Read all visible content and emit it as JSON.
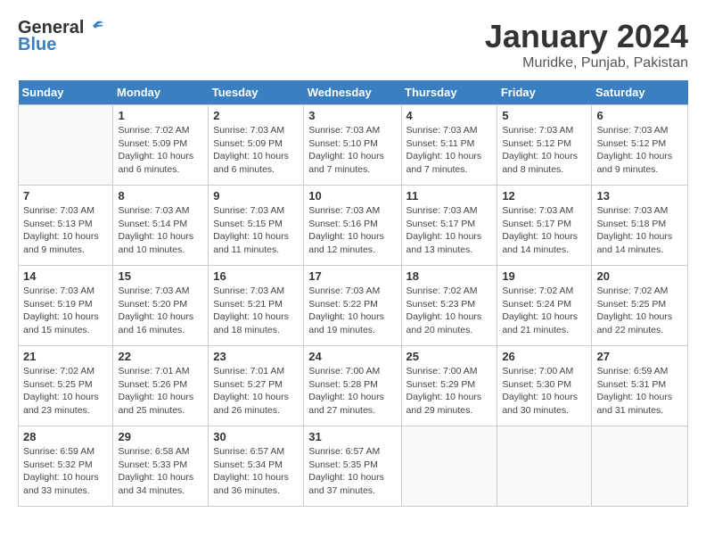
{
  "header": {
    "logo_general": "General",
    "logo_blue": "Blue",
    "month_year": "January 2024",
    "location": "Muridke, Punjab, Pakistan"
  },
  "columns": [
    "Sunday",
    "Monday",
    "Tuesday",
    "Wednesday",
    "Thursday",
    "Friday",
    "Saturday"
  ],
  "weeks": [
    [
      {
        "day": "",
        "info": ""
      },
      {
        "day": "1",
        "info": "Sunrise: 7:02 AM\nSunset: 5:09 PM\nDaylight: 10 hours\nand 6 minutes."
      },
      {
        "day": "2",
        "info": "Sunrise: 7:03 AM\nSunset: 5:09 PM\nDaylight: 10 hours\nand 6 minutes."
      },
      {
        "day": "3",
        "info": "Sunrise: 7:03 AM\nSunset: 5:10 PM\nDaylight: 10 hours\nand 7 minutes."
      },
      {
        "day": "4",
        "info": "Sunrise: 7:03 AM\nSunset: 5:11 PM\nDaylight: 10 hours\nand 7 minutes."
      },
      {
        "day": "5",
        "info": "Sunrise: 7:03 AM\nSunset: 5:12 PM\nDaylight: 10 hours\nand 8 minutes."
      },
      {
        "day": "6",
        "info": "Sunrise: 7:03 AM\nSunset: 5:12 PM\nDaylight: 10 hours\nand 9 minutes."
      }
    ],
    [
      {
        "day": "7",
        "info": "Sunrise: 7:03 AM\nSunset: 5:13 PM\nDaylight: 10 hours\nand 9 minutes."
      },
      {
        "day": "8",
        "info": "Sunrise: 7:03 AM\nSunset: 5:14 PM\nDaylight: 10 hours\nand 10 minutes."
      },
      {
        "day": "9",
        "info": "Sunrise: 7:03 AM\nSunset: 5:15 PM\nDaylight: 10 hours\nand 11 minutes."
      },
      {
        "day": "10",
        "info": "Sunrise: 7:03 AM\nSunset: 5:16 PM\nDaylight: 10 hours\nand 12 minutes."
      },
      {
        "day": "11",
        "info": "Sunrise: 7:03 AM\nSunset: 5:17 PM\nDaylight: 10 hours\nand 13 minutes."
      },
      {
        "day": "12",
        "info": "Sunrise: 7:03 AM\nSunset: 5:17 PM\nDaylight: 10 hours\nand 14 minutes."
      },
      {
        "day": "13",
        "info": "Sunrise: 7:03 AM\nSunset: 5:18 PM\nDaylight: 10 hours\nand 14 minutes."
      }
    ],
    [
      {
        "day": "14",
        "info": "Sunrise: 7:03 AM\nSunset: 5:19 PM\nDaylight: 10 hours\nand 15 minutes."
      },
      {
        "day": "15",
        "info": "Sunrise: 7:03 AM\nSunset: 5:20 PM\nDaylight: 10 hours\nand 16 minutes."
      },
      {
        "day": "16",
        "info": "Sunrise: 7:03 AM\nSunset: 5:21 PM\nDaylight: 10 hours\nand 18 minutes."
      },
      {
        "day": "17",
        "info": "Sunrise: 7:03 AM\nSunset: 5:22 PM\nDaylight: 10 hours\nand 19 minutes."
      },
      {
        "day": "18",
        "info": "Sunrise: 7:02 AM\nSunset: 5:23 PM\nDaylight: 10 hours\nand 20 minutes."
      },
      {
        "day": "19",
        "info": "Sunrise: 7:02 AM\nSunset: 5:24 PM\nDaylight: 10 hours\nand 21 minutes."
      },
      {
        "day": "20",
        "info": "Sunrise: 7:02 AM\nSunset: 5:25 PM\nDaylight: 10 hours\nand 22 minutes."
      }
    ],
    [
      {
        "day": "21",
        "info": "Sunrise: 7:02 AM\nSunset: 5:25 PM\nDaylight: 10 hours\nand 23 minutes."
      },
      {
        "day": "22",
        "info": "Sunrise: 7:01 AM\nSunset: 5:26 PM\nDaylight: 10 hours\nand 25 minutes."
      },
      {
        "day": "23",
        "info": "Sunrise: 7:01 AM\nSunset: 5:27 PM\nDaylight: 10 hours\nand 26 minutes."
      },
      {
        "day": "24",
        "info": "Sunrise: 7:00 AM\nSunset: 5:28 PM\nDaylight: 10 hours\nand 27 minutes."
      },
      {
        "day": "25",
        "info": "Sunrise: 7:00 AM\nSunset: 5:29 PM\nDaylight: 10 hours\nand 29 minutes."
      },
      {
        "day": "26",
        "info": "Sunrise: 7:00 AM\nSunset: 5:30 PM\nDaylight: 10 hours\nand 30 minutes."
      },
      {
        "day": "27",
        "info": "Sunrise: 6:59 AM\nSunset: 5:31 PM\nDaylight: 10 hours\nand 31 minutes."
      }
    ],
    [
      {
        "day": "28",
        "info": "Sunrise: 6:59 AM\nSunset: 5:32 PM\nDaylight: 10 hours\nand 33 minutes."
      },
      {
        "day": "29",
        "info": "Sunrise: 6:58 AM\nSunset: 5:33 PM\nDaylight: 10 hours\nand 34 minutes."
      },
      {
        "day": "30",
        "info": "Sunrise: 6:57 AM\nSunset: 5:34 PM\nDaylight: 10 hours\nand 36 minutes."
      },
      {
        "day": "31",
        "info": "Sunrise: 6:57 AM\nSunset: 5:35 PM\nDaylight: 10 hours\nand 37 minutes."
      },
      {
        "day": "",
        "info": ""
      },
      {
        "day": "",
        "info": ""
      },
      {
        "day": "",
        "info": ""
      }
    ]
  ]
}
